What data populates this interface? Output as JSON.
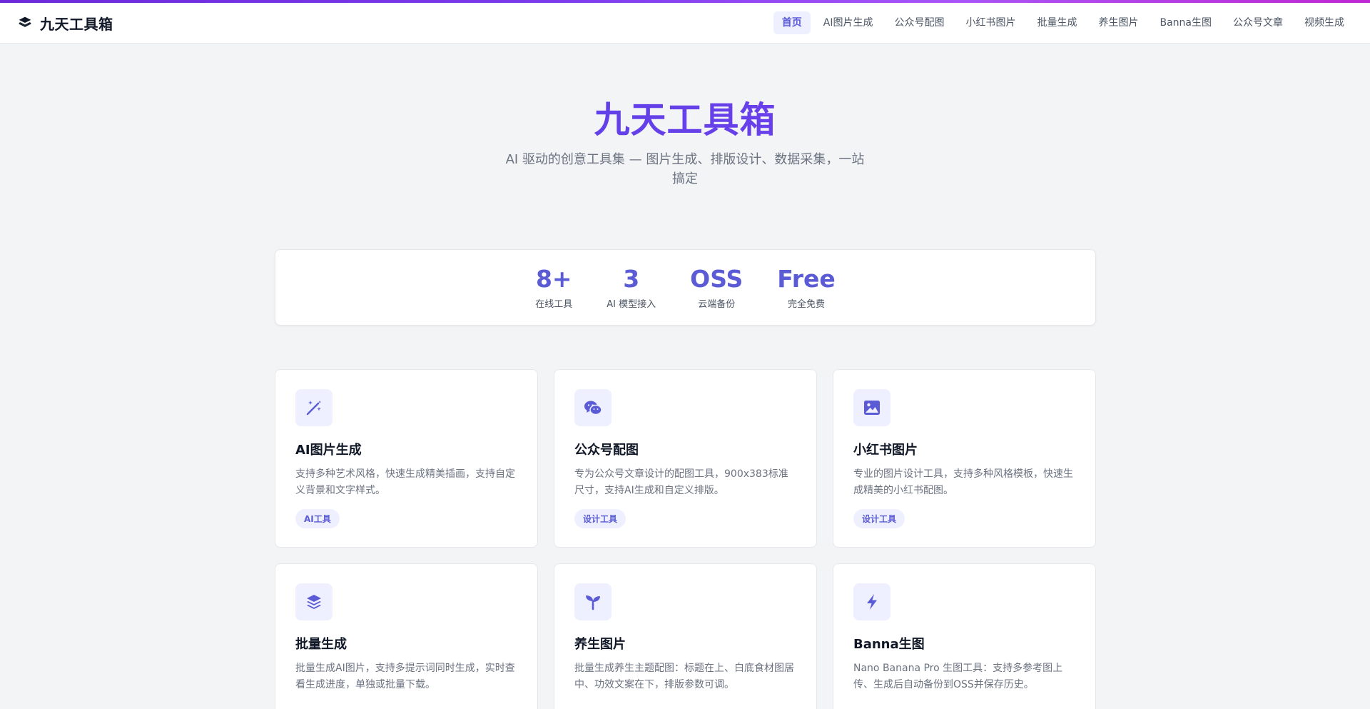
{
  "brand": {
    "title": "九天工具箱",
    "icon": "layers-icon"
  },
  "nav": [
    {
      "label": "首页",
      "active": true
    },
    {
      "label": "AI图片生成",
      "active": false
    },
    {
      "label": "公众号配图",
      "active": false
    },
    {
      "label": "小红书图片",
      "active": false
    },
    {
      "label": "批量生成",
      "active": false
    },
    {
      "label": "养生图片",
      "active": false
    },
    {
      "label": "Banna生图",
      "active": false
    },
    {
      "label": "公众号文章",
      "active": false
    },
    {
      "label": "视频生成",
      "active": false
    }
  ],
  "hero": {
    "title": "九天工具箱",
    "subtitle": "AI 驱动的创意工具集 — 图片生成、排版设计、数据采集，一站搞定"
  },
  "stats": [
    {
      "value": "8+",
      "label": "在线工具"
    },
    {
      "value": "3",
      "label": "AI 模型接入"
    },
    {
      "value": "OSS",
      "label": "云端备份"
    },
    {
      "value": "Free",
      "label": "完全免费"
    }
  ],
  "cards": [
    {
      "icon": "magic-wand-icon",
      "title": "AI图片生成",
      "desc": "支持多种艺术风格，快速生成精美插画，支持自定义背景和文字样式。",
      "tag": "AI工具"
    },
    {
      "icon": "wechat-icon",
      "title": "公众号配图",
      "desc": "专为公众号文章设计的配图工具，900x383标准尺寸，支持AI生成和自定义排版。",
      "tag": "设计工具"
    },
    {
      "icon": "image-icon",
      "title": "小红书图片",
      "desc": "专业的图片设计工具，支持多种风格模板，快速生成精美的小红书配图。",
      "tag": "设计工具"
    },
    {
      "icon": "layers-icon",
      "title": "批量生成",
      "desc": "批量生成AI图片，支持多提示词同时生成，实时查看生成进度，单独或批量下载。",
      "tag": ""
    },
    {
      "icon": "seedling-icon",
      "title": "养生图片",
      "desc": "批量生成养生主题配图：标题在上、白底食材图居中、功效文案在下，排版参数可调。",
      "tag": ""
    },
    {
      "icon": "bolt-icon",
      "title": "Banna生图",
      "desc": "Nano Banana Pro 生图工具：支持多参考图上传、生成后自动备份到OSS并保存历史。",
      "tag": ""
    }
  ]
}
